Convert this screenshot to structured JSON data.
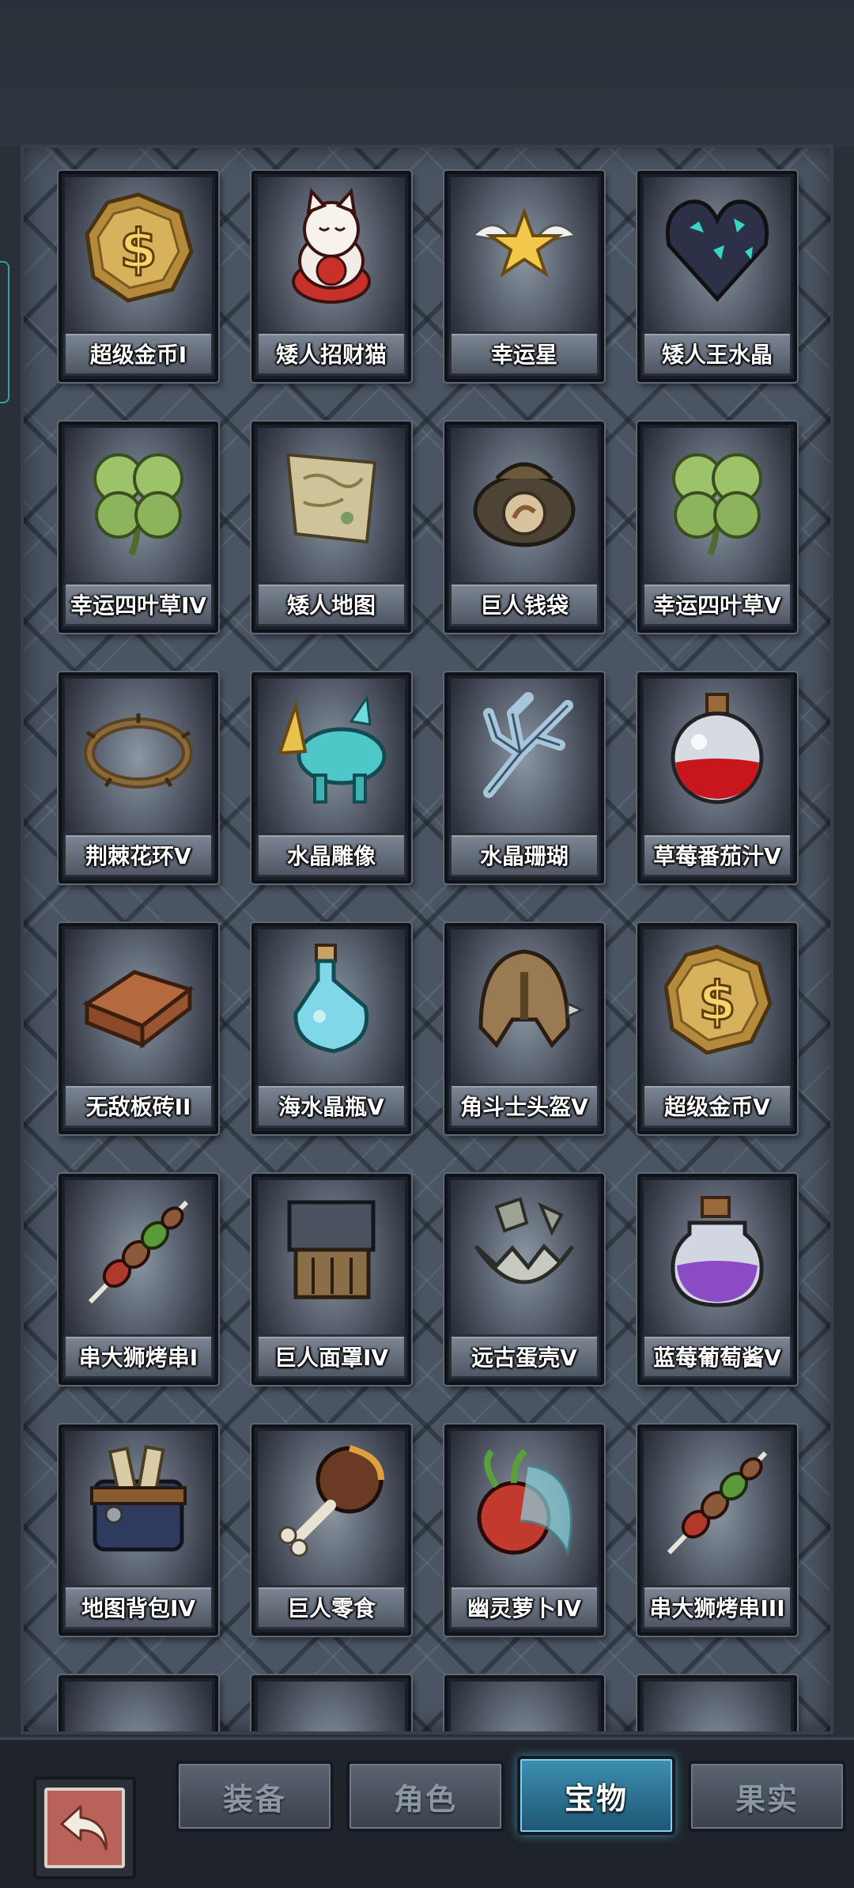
{
  "rows": [
    [
      {
        "label": "超级金币I",
        "icon": "gold-coin-icon"
      },
      {
        "label": "矮人招财猫",
        "icon": "lucky-cat-icon"
      },
      {
        "label": "幸运星",
        "icon": "winged-star-icon"
      },
      {
        "label": "矮人王水晶",
        "icon": "crystal-heart-icon"
      }
    ],
    [
      {
        "label": "幸运四叶草IV",
        "icon": "four-leaf-clover-icon"
      },
      {
        "label": "矮人地图",
        "icon": "map-scroll-icon"
      },
      {
        "label": "巨人钱袋",
        "icon": "money-bag-icon"
      },
      {
        "label": "幸运四叶草V",
        "icon": "four-leaf-clover-icon"
      }
    ],
    [
      {
        "label": "荆棘花环V",
        "icon": "thorn-wreath-icon"
      },
      {
        "label": "水晶雕像",
        "icon": "crystal-rhino-icon"
      },
      {
        "label": "水晶珊瑚",
        "icon": "crystal-coral-icon"
      },
      {
        "label": "草莓番茄汁V",
        "icon": "red-potion-icon"
      }
    ],
    [
      {
        "label": "无敌板砖II",
        "icon": "brick-icon"
      },
      {
        "label": "海水晶瓶V",
        "icon": "blue-bottle-icon"
      },
      {
        "label": "角斗士头盔V",
        "icon": "gladiator-helmet-icon"
      },
      {
        "label": "超级金币V",
        "icon": "gold-coin-icon"
      }
    ],
    [
      {
        "label": "串大狮烤串I",
        "icon": "skewer-icon"
      },
      {
        "label": "巨人面罩IV",
        "icon": "giant-mask-icon"
      },
      {
        "label": "远古蛋壳V",
        "icon": "eggshell-icon"
      },
      {
        "label": "蓝莓葡萄酱V",
        "icon": "purple-jar-icon"
      }
    ],
    [
      {
        "label": "地图背包IV",
        "icon": "map-backpack-icon"
      },
      {
        "label": "巨人零食",
        "icon": "bone-snack-icon"
      },
      {
        "label": "幽灵萝卜IV",
        "icon": "ghost-radish-icon"
      },
      {
        "label": "串大狮烤串III",
        "icon": "skewer-icon"
      }
    ],
    [
      {
        "label": "",
        "icon": "barrel-icon"
      },
      {
        "label": "",
        "icon": "rock-icon"
      },
      {
        "label": "",
        "icon": "donut-icon"
      },
      {
        "label": "",
        "icon": "cherry-cake-icon"
      }
    ]
  ],
  "tabs": [
    {
      "label": "装备",
      "active": false
    },
    {
      "label": "角色",
      "active": false
    },
    {
      "label": "宝物",
      "active": true
    },
    {
      "label": "果实",
      "active": false
    }
  ],
  "back_icon": "back-arrow-icon"
}
